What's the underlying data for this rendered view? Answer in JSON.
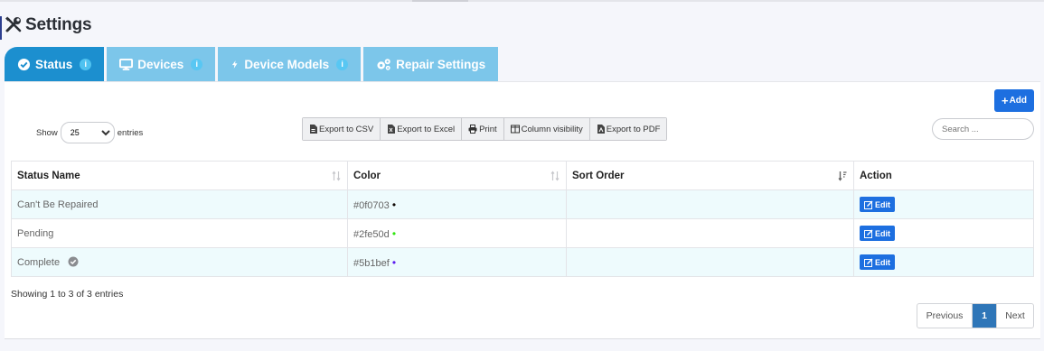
{
  "header": {
    "title": "Settings",
    "icon": "tools-icon"
  },
  "tabs": [
    {
      "label": "Status",
      "icon": "check-circle-icon",
      "info": "i",
      "active": true
    },
    {
      "label": "Devices",
      "icon": "monitor-icon",
      "info": "i",
      "active": false
    },
    {
      "label": "Device Models",
      "icon": "bolt-icon",
      "info": "i",
      "active": false
    },
    {
      "label": "Repair Settings",
      "icon": "gears-icon",
      "active": false
    }
  ],
  "toolbar": {
    "add_label": "Add",
    "show_label": "Show",
    "entries_label": "entries",
    "page_size": "25",
    "search_placeholder": "Search ...",
    "buttons": [
      "Export to CSV",
      "Export to Excel",
      "Print",
      "Column visibility",
      "Export to PDF"
    ]
  },
  "table": {
    "columns": [
      "Status Name",
      "Color",
      "Sort Order",
      "Action"
    ],
    "rows": [
      {
        "name": "Can't Be Repaired",
        "color": "#0f0703",
        "sort": "",
        "action": "Edit",
        "complete_icon": false
      },
      {
        "name": "Pending",
        "color": "#2fe50d",
        "sort": "",
        "action": "Edit",
        "complete_icon": false
      },
      {
        "name": "Complete",
        "color": "#5b1bef",
        "sort": "",
        "action": "Edit",
        "complete_icon": true
      }
    ]
  },
  "footer": {
    "info": "Showing 1 to 3 of 3 entries",
    "prev": "Previous",
    "page": "1",
    "next": "Next"
  },
  "colors": {
    "tab_active": "#1c8fcf",
    "tab_inactive": "#7cc6ea",
    "primary_button": "#1d6fe0",
    "row_stripe": "#eefbfd",
    "pager_active": "#2f76b8"
  }
}
